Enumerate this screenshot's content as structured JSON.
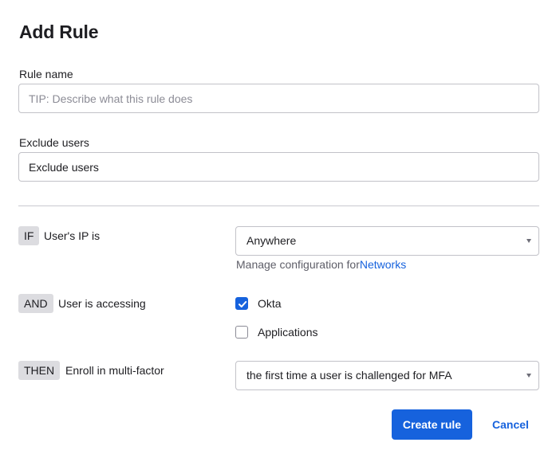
{
  "dialog": {
    "title": "Add Rule"
  },
  "rule_name": {
    "label": "Rule name",
    "value": "",
    "placeholder": "TIP: Describe what this rule does"
  },
  "exclude_users": {
    "label": "Exclude users",
    "value": "Exclude users"
  },
  "conditions": {
    "if": {
      "tag": "IF",
      "label": "User's IP is",
      "selected": "Anywhere",
      "helper_prefix": "Manage configuration for",
      "helper_link": "Networks"
    },
    "and": {
      "tag": "AND",
      "label": "User is accessing",
      "options": [
        {
          "label": "Okta",
          "checked": true
        },
        {
          "label": "Applications",
          "checked": false
        }
      ]
    },
    "then": {
      "tag": "THEN",
      "label": "Enroll in multi-factor",
      "selected": "the first time a user is challenged for MFA"
    }
  },
  "actions": {
    "create_label": "Create rule",
    "cancel_label": "Cancel"
  },
  "colors": {
    "primary": "#1662dd",
    "tag_bg": "#dcdce0",
    "border": "#c2c2c8"
  }
}
